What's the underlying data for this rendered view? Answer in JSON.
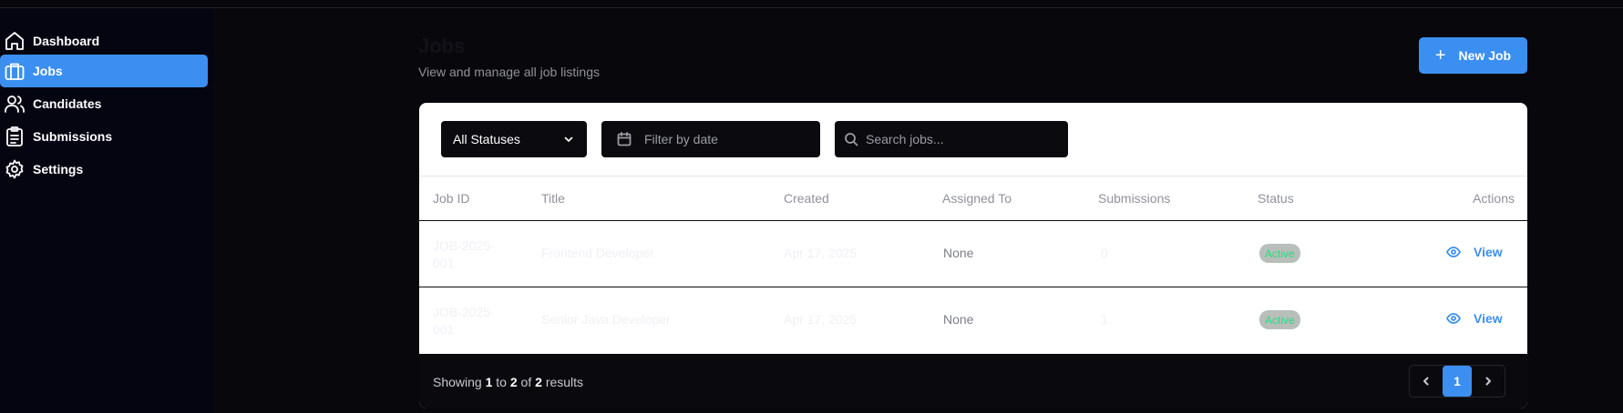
{
  "sidebar": {
    "items": [
      {
        "label": "Dashboard",
        "icon": "home-icon",
        "active": false
      },
      {
        "label": "Jobs",
        "icon": "briefcase-icon",
        "active": true
      },
      {
        "label": "Candidates",
        "icon": "users-icon",
        "active": false
      },
      {
        "label": "Submissions",
        "icon": "clipboard-icon",
        "active": false
      },
      {
        "label": "Settings",
        "icon": "gear-icon",
        "active": false
      }
    ]
  },
  "header": {
    "title": "Jobs",
    "subtitle": "View and manage all job listings",
    "new_job_label": "New Job"
  },
  "filters": {
    "status_value": "All Statuses",
    "date_placeholder": "Filter by date",
    "search_placeholder": "Search jobs..."
  },
  "table": {
    "columns": [
      "Job ID",
      "Title",
      "Created",
      "Assigned To",
      "Submissions",
      "Status",
      "Actions"
    ],
    "rows": [
      {
        "job_id": "JOB-2025-001",
        "title": "Frontend Developer",
        "created": "Apr 17, 2025",
        "assigned_to": "None",
        "submissions": "0",
        "status": "Active",
        "action": "View"
      },
      {
        "job_id": "JOB-2025-001",
        "title": "Senior Java Developer",
        "created": "Apr 17, 2025",
        "assigned_to": "None",
        "submissions": "1",
        "status": "Active",
        "action": "View"
      }
    ]
  },
  "pagination": {
    "showing_prefix": "Showing",
    "from": "1",
    "to_word": "to",
    "to": "2",
    "of_word": "of",
    "total": "2",
    "suffix": "results",
    "current_page": "1"
  },
  "colors": {
    "accent": "#3b8ff0",
    "sidebar_bg": "#050512",
    "page_bg": "#08080c",
    "badge_text": "#1ee07b"
  }
}
